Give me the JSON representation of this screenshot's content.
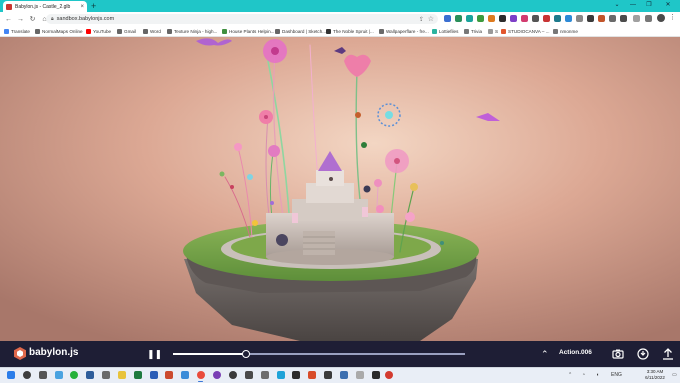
{
  "browser": {
    "tab_title": "Babylon.js - Castle_2.glb",
    "url": "sandbox.babylonjs.com",
    "new_tab_symbol": "+",
    "tab_close_symbol": "×",
    "window_controls": [
      "⌄",
      "—",
      "❐",
      "✕"
    ]
  },
  "bookmarks": [
    {
      "label": "Translate",
      "icon_color": "#4285f4"
    },
    {
      "label": "NormalMaps Online",
      "icon_color": "#666666"
    },
    {
      "label": "YouTube",
      "icon_color": "#ff0000"
    },
    {
      "label": "Gmail",
      "icon_color": "#666666"
    },
    {
      "label": "Word",
      "icon_color": "#666666"
    },
    {
      "label": "Texture Ninja - high...",
      "icon_color": "#666666"
    },
    {
      "label": "House Plants Helpin...",
      "icon_color": "#3f8f3f"
    },
    {
      "label": "Dashboard | Sketch...",
      "icon_color": "#666666"
    },
    {
      "label": "The Noble Spruit |...",
      "icon_color": "#333333"
    },
    {
      "label": "Wallpaperflare - fre...",
      "icon_color": "#6a6a6a"
    },
    {
      "label": "Lottiefiles",
      "icon_color": "#2ab39f"
    },
    {
      "label": "Trivia",
      "icon_color": "#777777"
    },
    {
      "label": "S",
      "icon_color": "#999999"
    },
    {
      "label": "STUDIOCANVA – ...",
      "icon_color": "#e2562d"
    },
    {
      "label": "nmonme",
      "icon_color": "#777777"
    }
  ],
  "player": {
    "brand": "babylon.js",
    "animation_name": "Action.006",
    "progress_fraction": 0.25
  },
  "taskbar": {
    "clock_time": "3:30 AM",
    "clock_date": "6/11/2022",
    "tray_text": "ENG"
  },
  "colors": {
    "tab_strip": "#1fc6c8",
    "player_bar": "#1e1e35",
    "taskbar": "#e9eef6"
  }
}
